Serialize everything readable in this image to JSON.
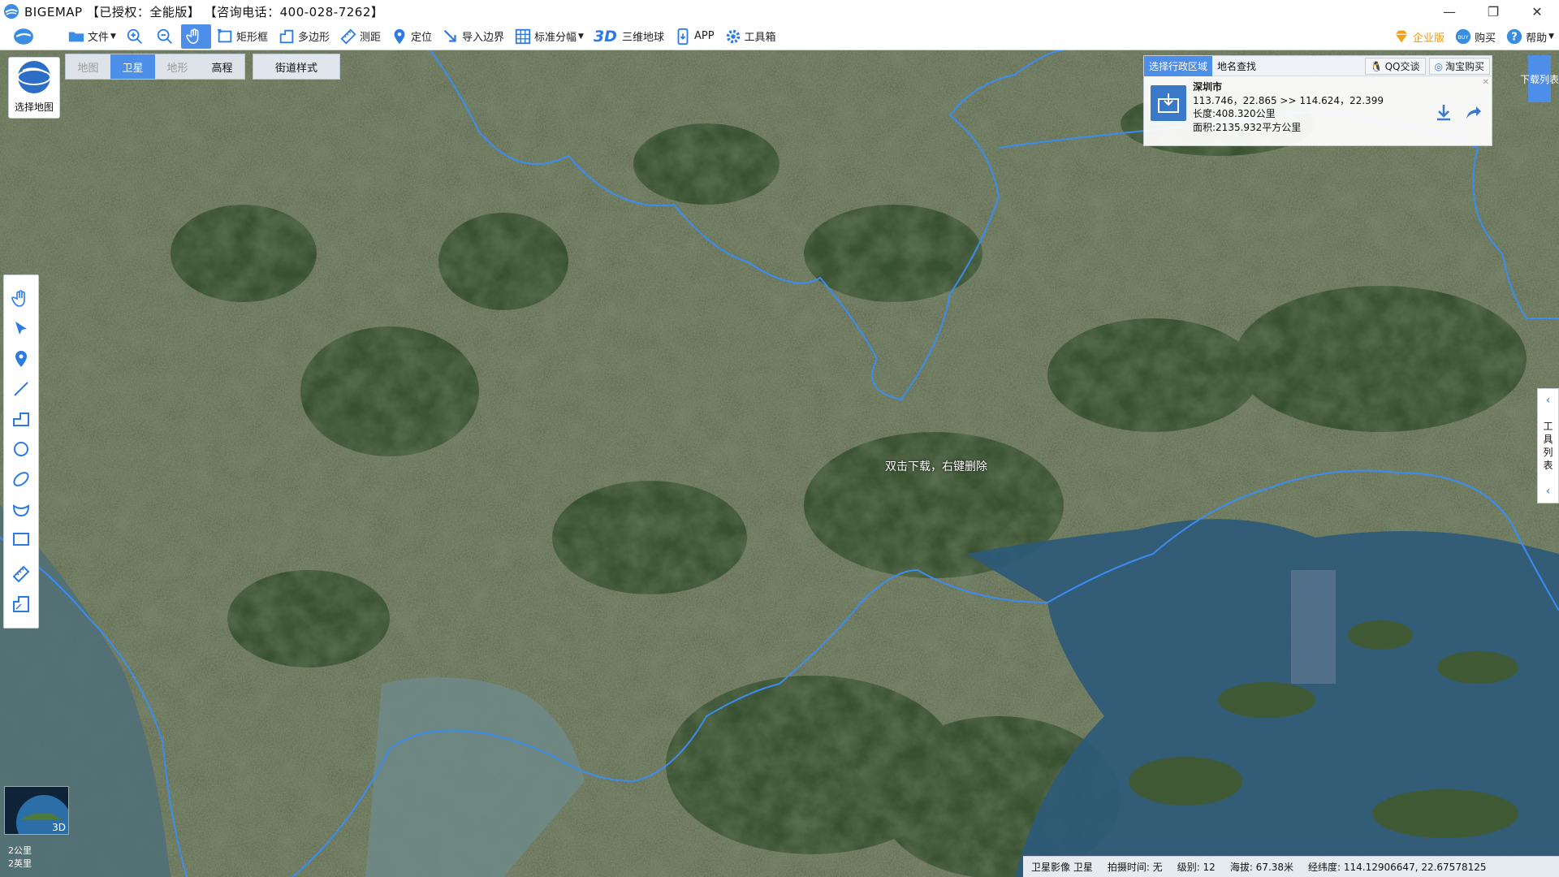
{
  "window": {
    "title": "BIGEMAP 【已授权：全能版】 【咨询电话：400-028-7262】",
    "controls": [
      "—",
      "❐",
      "✕"
    ]
  },
  "toolbar": {
    "file": "文件",
    "rect": "矩形框",
    "poly": "多边形",
    "measure": "测距",
    "locate": "定位",
    "import_boundary": "导入边界",
    "std_sheet": "标准分幅",
    "three_d_label": "3D",
    "earth3d": "三维地球",
    "app": "APP",
    "toolbox": "工具箱",
    "enterprise": "企业版",
    "buy": "购买",
    "help": "帮助"
  },
  "map_select": {
    "label": "选择地图"
  },
  "map_tabs": [
    "地图",
    "卫星",
    "地形",
    "高程"
  ],
  "street_style": "街道样式",
  "panel": {
    "tabs": [
      "选择行政区域",
      "地名查找"
    ],
    "qq": "QQ交谈",
    "taobao": "淘宝购买",
    "city": "深圳市",
    "coords": "113.746，22.865 >> 114.624，22.399",
    "length": "长度:408.320公里",
    "area": "面积:2135.932平方公里"
  },
  "download_list": "下载列表",
  "tool_list": "工具列表",
  "hint": "双击下载，右键删除",
  "minimap": {
    "label": "3D"
  },
  "scale": {
    "km": "2公里",
    "mi": "2英里"
  },
  "status": {
    "source": "卫星影像 卫星",
    "capture_time": "拍摄时间: 无",
    "level": "级别:  12",
    "altitude": "海拔: 67.38米",
    "lonlat": "经纬度:  114.12906647, 22.67578125"
  },
  "colors": {
    "accent": "#4c8ee8",
    "boundary": "#3b8cf0",
    "sea": "#2e5a78"
  }
}
